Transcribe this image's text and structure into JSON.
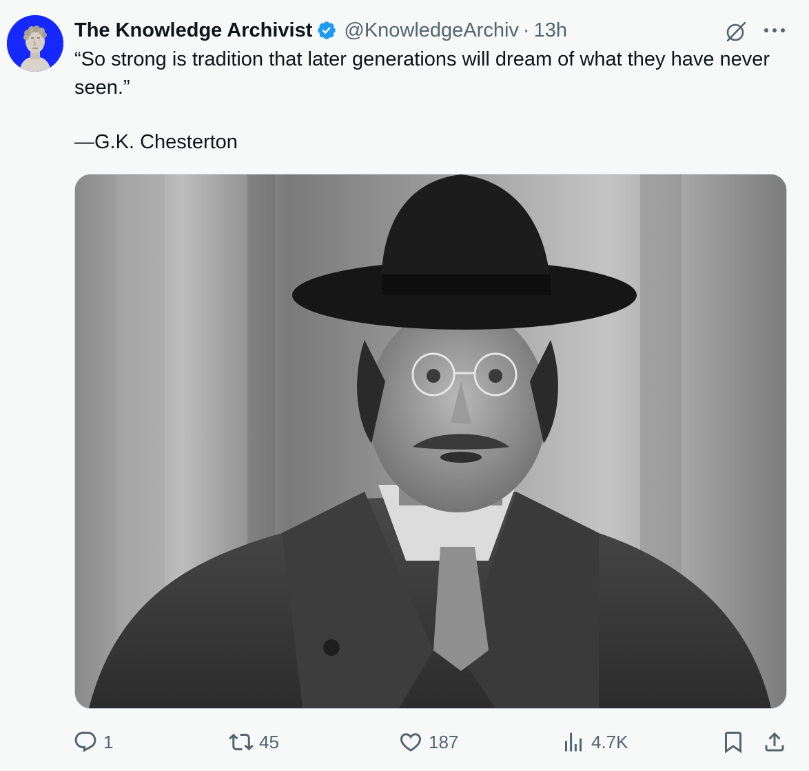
{
  "author": {
    "display_name": "The Knowledge Archivist",
    "handle": "@KnowledgeArchiv",
    "separator": "·",
    "time": "13h",
    "verified": true,
    "avatar_bg": "#1428ff"
  },
  "tweet": {
    "quote": "“So strong is tradition that later generations will dream of what they have never seen.”",
    "attribution": "—G.K. Chesterton"
  },
  "media": {
    "type": "photo",
    "style": "black-and-white portrait"
  },
  "actions": {
    "replies": "1",
    "reposts": "45",
    "likes": "187",
    "views": "4.7K"
  },
  "icons": {
    "verified": "verified-badge-icon",
    "grok": "grok-icon",
    "more": "more-icon",
    "reply": "reply-icon",
    "repost": "repost-icon",
    "like": "like-icon",
    "views": "views-icon",
    "bookmark": "bookmark-icon",
    "share": "share-icon"
  },
  "colors": {
    "text": "#0f1419",
    "secondary": "#536471",
    "verified": "#1d9bf0",
    "background": "#f7f9f9"
  }
}
